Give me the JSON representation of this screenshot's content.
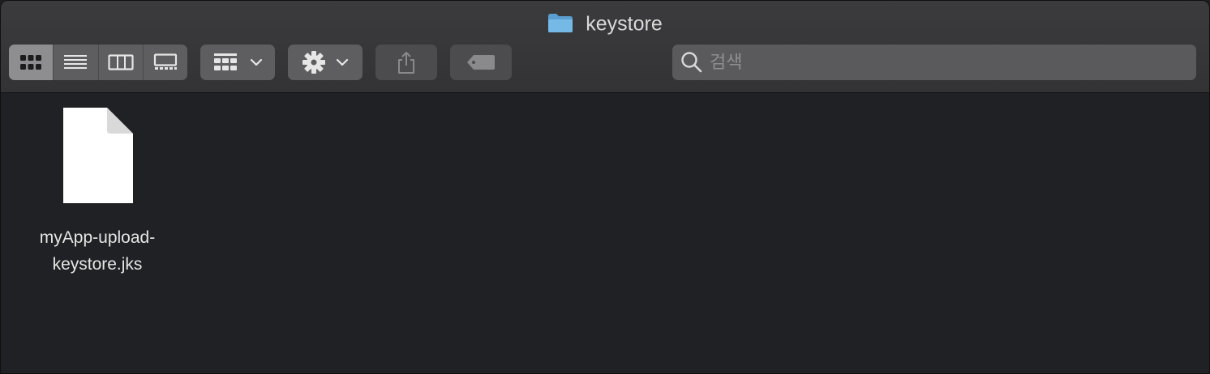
{
  "window": {
    "title": "keystore"
  },
  "toolbar": {
    "view_modes": [
      "icon-view",
      "list-view",
      "column-view",
      "gallery-view"
    ],
    "search": {
      "placeholder": "검색"
    }
  },
  "files": [
    {
      "name_line1": "myApp-upload-",
      "name_line2": "keystore.jks"
    }
  ]
}
